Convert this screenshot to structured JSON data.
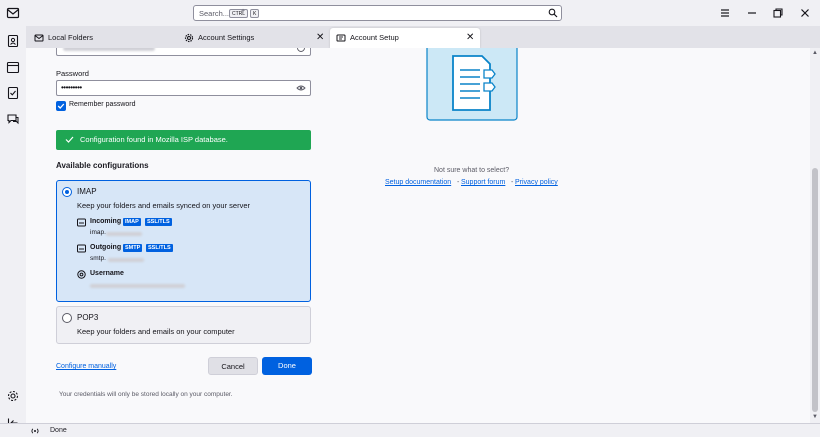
{
  "search": {
    "placeholder": "Search...",
    "shortcut_key1": "CTRL",
    "shortcut_plus": "+",
    "shortcut_key2": "K"
  },
  "tabs": [
    {
      "label": "Local Folders",
      "icon": "mail-icon"
    },
    {
      "label": "Account Settings",
      "icon": "gear-icon"
    },
    {
      "label": "Account Setup",
      "icon": "account-setup-icon",
      "selected": true
    }
  ],
  "form": {
    "password_label": "Password",
    "password_value": "•••••••••",
    "remember_label": "Remember password",
    "remember_checked": true
  },
  "notice": {
    "text": "Configuration found in Mozilla ISP database.",
    "color": "#1fa653"
  },
  "configs": {
    "heading": "Available configurations",
    "imap": {
      "title": "IMAP",
      "description": "Keep your folders and emails synced on your server",
      "incoming_label": "Incoming",
      "incoming_badge1": "IMAP",
      "incoming_badge2": "SSL/TLS",
      "incoming_host_prefix": "imap.",
      "outgoing_label": "Outgoing",
      "outgoing_badge1": "SMTP",
      "outgoing_badge2": "SSL/TLS",
      "outgoing_host_prefix": "smtp.",
      "username_label": "Username"
    },
    "pop3": {
      "title": "POP3",
      "description": "Keep your folders and emails on your computer"
    }
  },
  "actions": {
    "configure_manually": "Configure manually",
    "cancel": "Cancel",
    "done": "Done"
  },
  "footnote": "Your credentials will only be stored locally on your computer.",
  "help": {
    "question": "Not sure what to select?",
    "links": [
      "Setup documentation",
      "Support forum",
      "Privacy policy"
    ],
    "separator": "-"
  },
  "status": {
    "text": "Done"
  },
  "colors": {
    "accent": "#0061e0",
    "selected_bg": "#d7e6f7"
  }
}
